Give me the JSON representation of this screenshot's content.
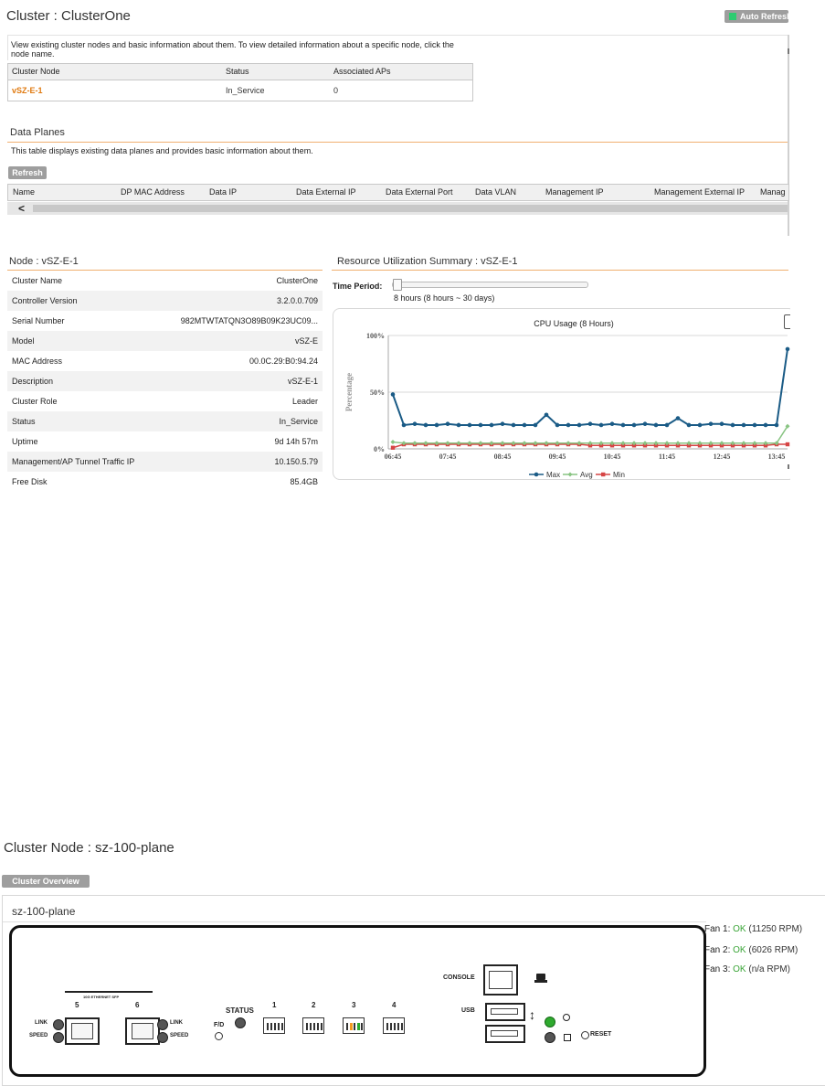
{
  "cluster": {
    "title": "Cluster : ClusterOne",
    "auto_refresh": "Auto Refresh",
    "description": "View existing cluster nodes and basic information about them. To view detailed information about a specific node, click the node name.",
    "columns": [
      "Cluster Node",
      "Status",
      "Associated APs"
    ],
    "rows": [
      {
        "node": "vSZ-E-1",
        "status": "In_Service",
        "aps": "0"
      }
    ]
  },
  "data_planes": {
    "title": "Data Planes",
    "description": "This table displays existing data planes and provides basic information about them.",
    "refresh_label": "Refresh",
    "columns": [
      "Name",
      "DP MAC Address",
      "Data IP",
      "Data External IP",
      "Data External Port",
      "Data VLAN",
      "Management IP",
      "Management External IP",
      "Manag"
    ],
    "scroll_left": "<"
  },
  "node": {
    "title": "Node : vSZ-E-1",
    "fields": [
      {
        "key": "Cluster Name",
        "value": "ClusterOne"
      },
      {
        "key": "Controller Version",
        "value": "3.2.0.0.709"
      },
      {
        "key": "Serial Number",
        "value": "982MTWTATQN3O89B09K23UC09..."
      },
      {
        "key": "Model",
        "value": "vSZ-E"
      },
      {
        "key": "MAC Address",
        "value": "00.0C.29:B0:94.24"
      },
      {
        "key": "Description",
        "value": "vSZ-E-1"
      },
      {
        "key": "Cluster Role",
        "value": "Leader"
      },
      {
        "key": "Status",
        "value": "In_Service"
      },
      {
        "key": "Uptime",
        "value": "9d 14h 57m"
      },
      {
        "key": "Management/AP Tunnel Traffic IP",
        "value": "10.150.5.79"
      },
      {
        "key": "Free Disk",
        "value": "85.4GB"
      }
    ]
  },
  "resource": {
    "title": "Resource Utilization Summary : vSZ-E-1",
    "time_period_label": "Time Period:",
    "time_period_value": "8 hours (8 hours ~ 30 days)",
    "slider_fraction": 0.0
  },
  "chart_data": {
    "type": "line",
    "title": "CPU Usage (8 Hours)",
    "ylabel": "Percentage",
    "xlabel": "",
    "ylim": [
      0,
      100
    ],
    "y_ticks": [
      "100%",
      "50%",
      "0%"
    ],
    "x_tick_labels": [
      "06:45",
      "07:45",
      "08:45",
      "09:45",
      "10:45",
      "11:45",
      "12:45",
      "13:45"
    ],
    "x_count": 37,
    "series": [
      {
        "name": "Max",
        "color": "#1a5b86",
        "marker": "circle",
        "values": [
          48,
          21,
          22,
          21,
          21,
          22,
          21,
          21,
          21,
          21,
          22,
          21,
          21,
          21,
          30,
          21,
          21,
          21,
          22,
          21,
          22,
          21,
          21,
          22,
          21,
          21,
          27,
          21,
          21,
          22,
          22,
          21,
          21,
          21,
          21,
          21,
          88
        ]
      },
      {
        "name": "Avg",
        "color": "#88c482",
        "marker": "diamond",
        "values": [
          6,
          5,
          5,
          5,
          5,
          5,
          5,
          5,
          5,
          5,
          5,
          5,
          5,
          5,
          5,
          5,
          5,
          5,
          5,
          5,
          5,
          5,
          5,
          5,
          5,
          5,
          5,
          5,
          5,
          5,
          5,
          5,
          5,
          5,
          5,
          5,
          20
        ]
      },
      {
        "name": "Min",
        "color": "#d64545",
        "marker": "square",
        "values": [
          1,
          4,
          4,
          4,
          4,
          4,
          4,
          4,
          4,
          4,
          4,
          4,
          4,
          4,
          4,
          4,
          4,
          4,
          3,
          3,
          3,
          3,
          3,
          3,
          3,
          3,
          3,
          3,
          3,
          3,
          3,
          3,
          3,
          3,
          3,
          4,
          4
        ]
      }
    ],
    "grid": true,
    "legend_position": "bottom"
  },
  "cluster_node": {
    "title": "Cluster Node : sz-100-plane",
    "overview_button": "Cluster Overview",
    "device_name": "sz-100-plane",
    "fans": [
      {
        "label": "Fan 1:",
        "status": "OK",
        "detail": "(11250 RPM)"
      },
      {
        "label": "Fan 2:",
        "status": "OK",
        "detail": "(6026 RPM)"
      },
      {
        "label": "Fan 3:",
        "status": "OK",
        "detail": "(n/a RPM)"
      }
    ],
    "panel": {
      "sfp_header": "10G ETHERNET SFP",
      "sfp_5": "5",
      "sfp_6": "6",
      "link": "LINK",
      "speed": "SPEED",
      "status": "STATUS",
      "fd": "F/D",
      "ports": [
        "1",
        "2",
        "3",
        "4"
      ],
      "console": "CONSOLE",
      "usb": "USB",
      "reset": "RESET"
    }
  }
}
